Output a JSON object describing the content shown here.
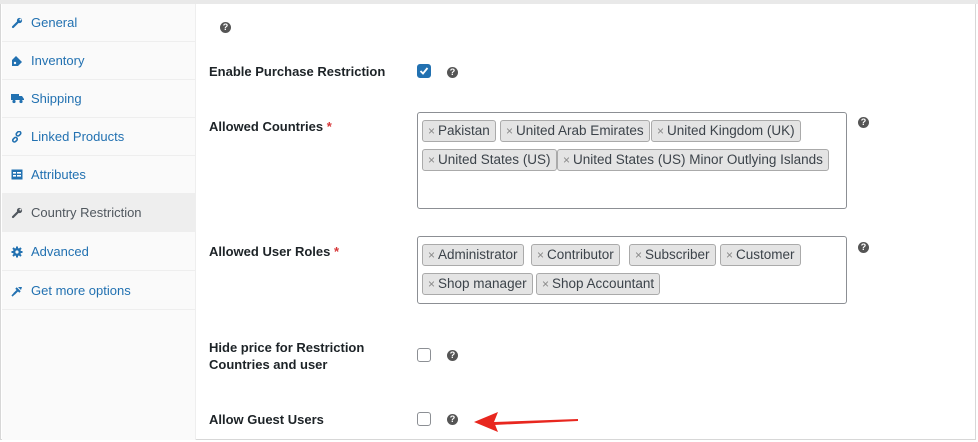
{
  "sidebar": {
    "items": [
      {
        "label": "General",
        "icon": "wrench-icon"
      },
      {
        "label": "Inventory",
        "icon": "tag-icon"
      },
      {
        "label": "Shipping",
        "icon": "truck-icon"
      },
      {
        "label": "Linked Products",
        "icon": "link-icon"
      },
      {
        "label": "Attributes",
        "icon": "table-icon"
      },
      {
        "label": "Country Restriction",
        "icon": "wrench-icon"
      },
      {
        "label": "Advanced",
        "icon": "gear-icon"
      },
      {
        "label": "Get more options",
        "icon": "plugin-icon"
      }
    ],
    "active_index": 5
  },
  "fields": {
    "enable_purchase_restriction": {
      "label": "Enable Purchase Restriction",
      "checked": true
    },
    "allowed_countries": {
      "label": "Allowed Countries",
      "required_mark": "*",
      "tags": [
        "Pakistan",
        "United Arab Emirates",
        "United Kingdom (UK)",
        "United States (US)",
        "United States (US) Minor Outlying Islands"
      ]
    },
    "allowed_user_roles": {
      "label": "Allowed User Roles",
      "required_mark": "*",
      "tags": [
        "Administrator",
        "Contributor",
        "Subscriber",
        "Customer",
        "Shop manager",
        "Shop Accountant"
      ]
    },
    "hide_price": {
      "label_line1": "Hide price for Restriction",
      "label_line2": "Countries and user",
      "checked": false
    },
    "allow_guest_users": {
      "label": "Allow Guest Users",
      "checked": false
    }
  },
  "tag_remove_glyph": "×",
  "help_glyph": "?",
  "colors": {
    "link": "#2271b1",
    "checkbox_checked": "#2271b1",
    "required": "#d63638",
    "arrow": "#e8271f"
  }
}
